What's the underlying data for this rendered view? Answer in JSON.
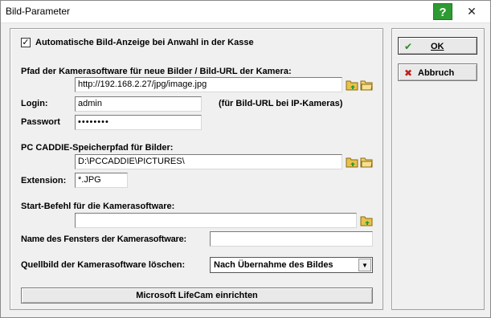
{
  "window": {
    "title": "Bild-Parameter",
    "help_glyph": "?",
    "close_glyph": "✕"
  },
  "form": {
    "auto_display_label": "Automatische Bild-Anzeige bei Anwahl in der Kasse",
    "auto_display_checked": "✓",
    "camera_path_label": "Pfad der Kamerasoftware für neue Bilder / Bild-URL der Kamera:",
    "camera_path_value": "http://192.168.2.27/jpg/image.jpg",
    "login_label": "Login:",
    "login_value": "admin",
    "login_hint": "(für Bild-URL bei IP-Kameras)",
    "password_label": "Passwort",
    "password_value": "••••••••",
    "save_path_label": "PC CADDIE-Speicherpfad für Bilder:",
    "save_path_value": "D:\\PCCADDIE\\PICTURES\\",
    "extension_label": "Extension:",
    "extension_value": "*.JPG",
    "start_cmd_label": "Start-Befehl für die Kamerasoftware:",
    "start_cmd_value": "",
    "window_name_label": "Name des Fensters der Kamerasoftware:",
    "window_name_value": "",
    "delete_source_label": "Quellbild der Kamerasoftware löschen:",
    "delete_source_value": "Nach Übernahme des Bildes",
    "lifecam_button": "Microsoft LifeCam einrichten"
  },
  "buttons": {
    "ok_label": "OK",
    "cancel_label": "Abbruch"
  },
  "icons": {
    "browse_green": "folder-arrow-icon",
    "browse_plain": "folder-icon",
    "ok": "checkmark-icon",
    "cancel": "red-x-icon"
  },
  "colors": {
    "help_green": "#2e9a32",
    "ok_check": "#2a8a2a",
    "cancel_red": "#c0201a"
  }
}
